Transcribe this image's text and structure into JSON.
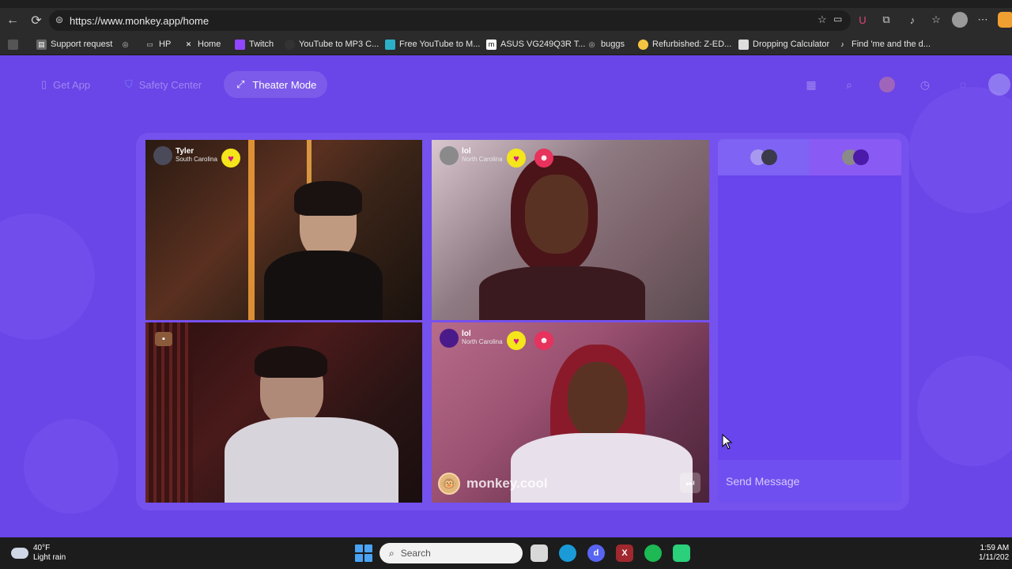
{
  "browser": {
    "url": "https://www.monkey.app/home",
    "bookmarks": [
      {
        "label": "Support request",
        "icon": "printer-icon"
      },
      {
        "label": "",
        "icon": "globe-icon"
      },
      {
        "label": "HP",
        "icon": "folder-icon"
      },
      {
        "label": "Home",
        "icon": "x-icon"
      },
      {
        "label": "Twitch",
        "icon": "twitch-icon"
      },
      {
        "label": "YouTube to MP3 C...",
        "icon": "disc-icon"
      },
      {
        "label": "Free YouTube to M...",
        "icon": "ytm-icon"
      },
      {
        "label": "ASUS VG249Q3R T...",
        "icon": "asus-icon"
      },
      {
        "label": "buggs",
        "icon": "globe-icon"
      },
      {
        "label": "Refurbished: Z-ED...",
        "icon": "egg-icon"
      },
      {
        "label": "Dropping Calculator",
        "icon": "calculator-icon"
      },
      {
        "label": "Find 'me and the d...",
        "icon": "tiktok-icon"
      }
    ]
  },
  "header": {
    "get_app": "Get App",
    "safety_center": "Safety Center",
    "theater_mode": "Theater Mode"
  },
  "tiles": [
    {
      "name": "Tyler",
      "location": "South Carolina"
    },
    {
      "name": "lol",
      "location": "North Carolina"
    },
    {
      "name": "",
      "location": ""
    },
    {
      "name": "lol",
      "location": "North Carolina"
    }
  ],
  "watermark": "monkey.cool",
  "chat": {
    "placeholder": "Send Message"
  },
  "taskbar": {
    "temperature": "40°F",
    "weather": "Light rain",
    "search": "Search",
    "time": "1:59 AM",
    "date": "1/11/202"
  },
  "colors": {
    "page_bg": "#6a45e8",
    "heart": "#f5e51b"
  }
}
